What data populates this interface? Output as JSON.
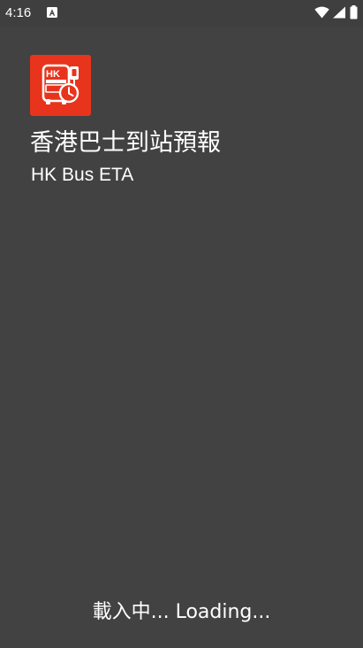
{
  "status_bar": {
    "time": "4:16",
    "icons": [
      "notification-a-icon",
      "wifi-icon",
      "signal-icon",
      "battery-icon"
    ]
  },
  "app": {
    "icon": "hk-bus-clock-icon",
    "icon_color": "#e8341c",
    "title_zh": "香港巴士到站預報",
    "title_en": "HK Bus ETA"
  },
  "loading": {
    "text": "載入中... Loading..."
  },
  "colors": {
    "background": "#424242",
    "text": "#ffffff"
  }
}
